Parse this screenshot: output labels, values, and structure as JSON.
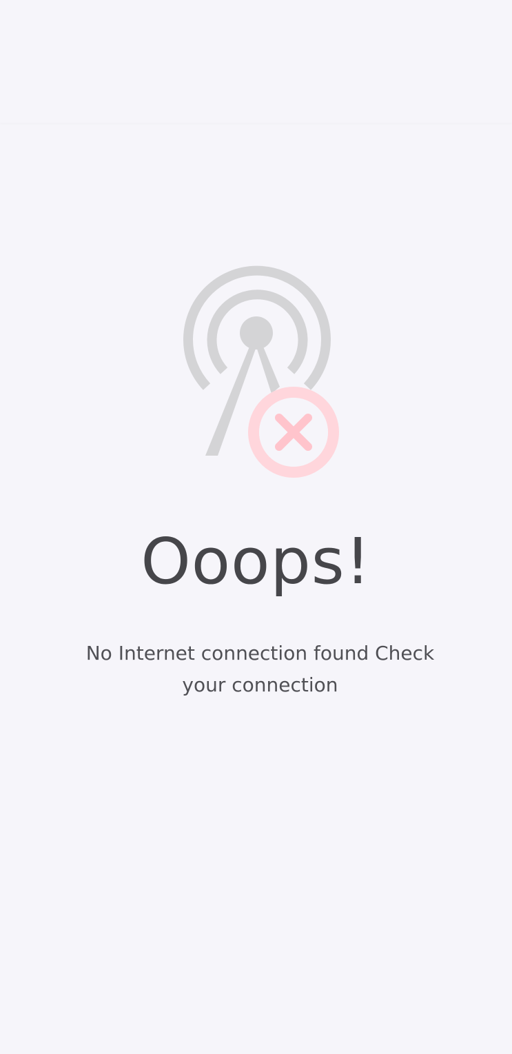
{
  "error_screen": {
    "title": "Ooops!",
    "message": "No Internet connection found Check your connection",
    "icon": "no-signal-antenna-icon"
  },
  "colors": {
    "background": "#f6f5fa",
    "antenna": "#d4d4d6",
    "error_badge": "#ffd6dc",
    "error_x": "#ffc4cc",
    "text": "#46464a"
  }
}
